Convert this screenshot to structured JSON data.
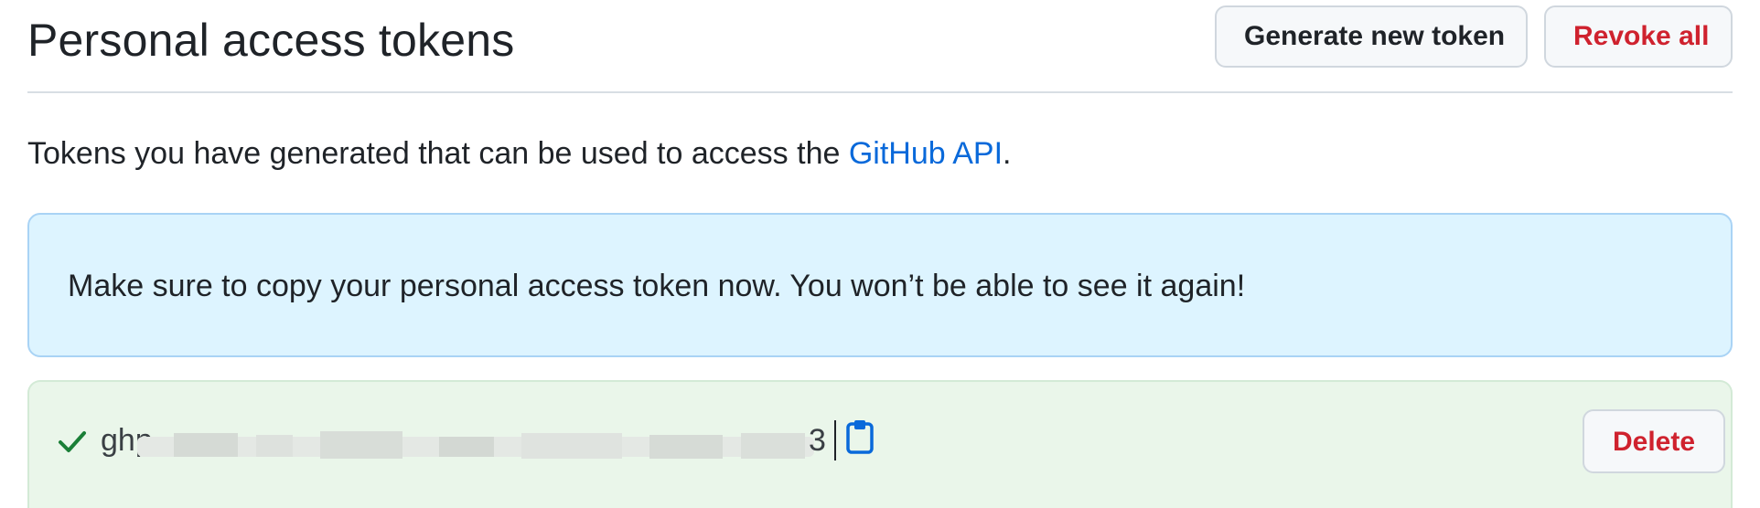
{
  "header": {
    "title": "Personal access tokens",
    "generate_label": "Generate new token",
    "revoke_label": "Revoke all"
  },
  "description": {
    "text_before": "Tokens you have generated that can be used to access the ",
    "link_text": "GitHub API",
    "text_after": "."
  },
  "flash": {
    "message": "Make sure to copy your personal access token now. You won’t be able to see it again!"
  },
  "token": {
    "prefix": "ghp_",
    "suffix": "3",
    "status_icon": "check-icon",
    "copy_icon": "clipboard-icon",
    "delete_label": "Delete"
  },
  "colors": {
    "link": "#0969da",
    "danger": "#cf222e",
    "flash_bg": "#ddf4ff",
    "success_bg": "#eaf6ea",
    "success_icon": "#1a7f37"
  }
}
